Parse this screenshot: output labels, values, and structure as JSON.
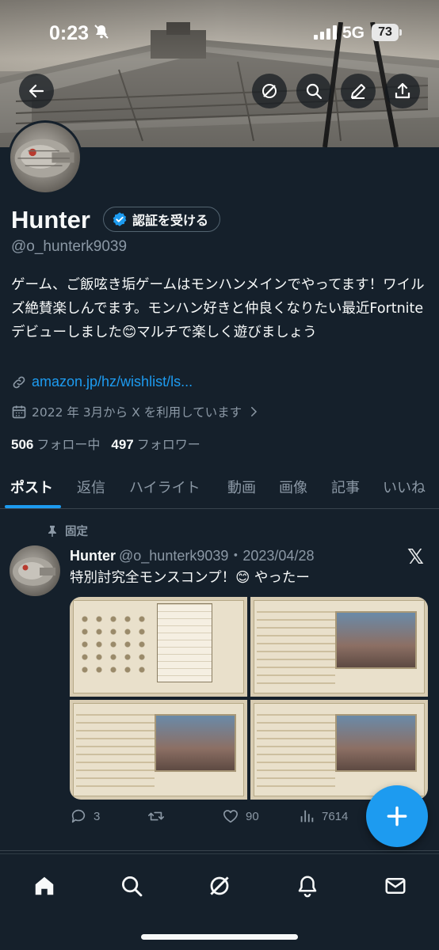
{
  "status_bar": {
    "time": "0:23",
    "network": "5G",
    "battery": "73"
  },
  "profile": {
    "name": "Hunter",
    "verify_label": "認証を受ける",
    "handle": "@o_hunterk9039",
    "bio": "ゲーム、ご飯呟き垢ゲームはモンハンメインでやってます！ワイルズ絶賛楽しんでます。モンハン好きと仲良くなりたい最近Fortniteデビューしました😊マルチで楽しく遊びましょう",
    "link": "amazon.jp/hz/wishlist/ls...",
    "joined": "2022 年 3月から X を利用しています",
    "following_count": "506",
    "following_label": "フォロー中",
    "followers_count": "497",
    "followers_label": "フォロワー"
  },
  "tabs": [
    "ポスト",
    "返信",
    "ハイライト",
    "動画",
    "画像",
    "記事",
    "いいね"
  ],
  "post": {
    "pinned_label": "固定",
    "author": "Hunter",
    "handle_date": "@o_hunterk9039・2023/04/28",
    "text": "特別討究全モンスコンプ！😊 やったー",
    "replies": "3",
    "likes": "90",
    "views": "7614"
  },
  "icons": {
    "back": "back-arrow-icon",
    "grok": "grok-icon",
    "search": "search-icon",
    "edit": "edit-icon",
    "share": "share-icon"
  },
  "colors": {
    "accent": "#1d9bf0",
    "background": "#15202b",
    "muted": "#8b98a5"
  }
}
